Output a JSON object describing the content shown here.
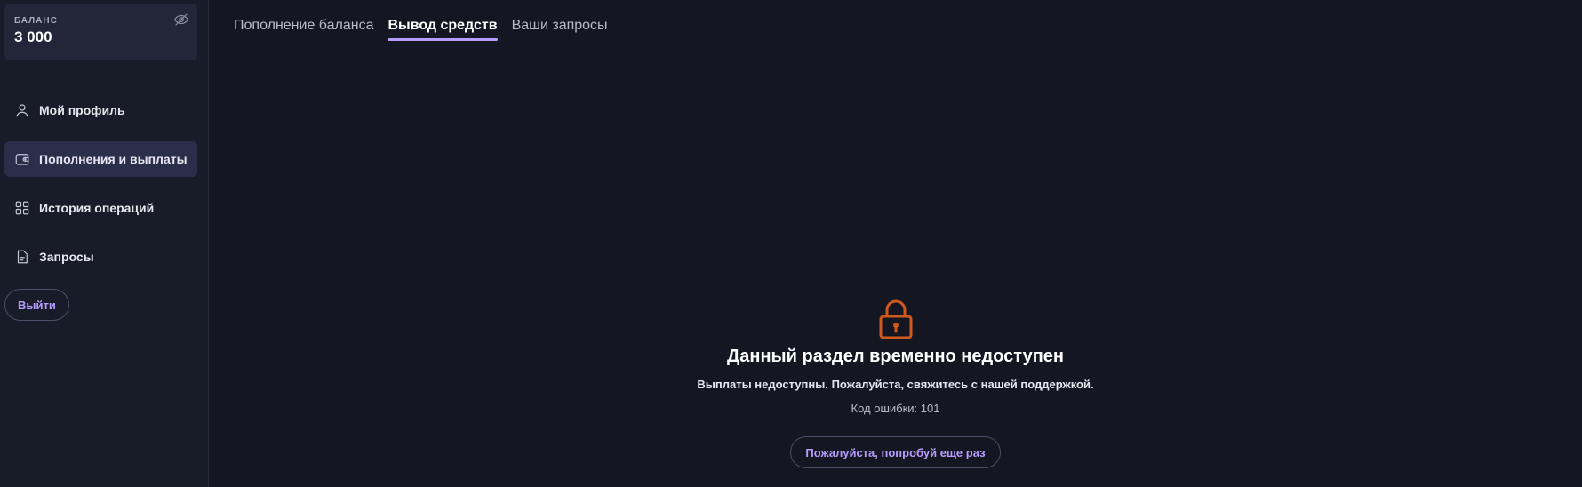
{
  "sidebar": {
    "balance": {
      "label": "БАЛАНС",
      "value": "3 000",
      "toggle_icon": "eye-off-icon"
    },
    "nav": [
      {
        "label": "Мой профиль",
        "icon": "user-icon",
        "active": false
      },
      {
        "label": "Пополнения и выплаты",
        "icon": "wallet-icon",
        "active": true
      },
      {
        "label": "История операций",
        "icon": "grid-icon",
        "active": false
      },
      {
        "label": "Запросы",
        "icon": "document-icon",
        "active": false
      }
    ],
    "logout_label": "Выйти"
  },
  "tabs": [
    {
      "label": "Пополнение баланса",
      "active": false
    },
    {
      "label": "Вывод средств",
      "active": true
    },
    {
      "label": "Ваши запросы",
      "active": false
    }
  ],
  "empty_state": {
    "icon": "lock-icon",
    "title": "Данный раздел временно недоступен",
    "description": "Выплаты недоступны. Пожалуйста, свяжитесь с нашей поддержкой.",
    "error_code": "Код ошибки: 101",
    "retry_label": "Пожалуйста, попробуй еще раз"
  },
  "colors": {
    "background": "#141722",
    "sidebar": "#181b28",
    "accent": "#b79cff",
    "active_nav": "#2a2e4b",
    "lock": "#d1581f"
  }
}
